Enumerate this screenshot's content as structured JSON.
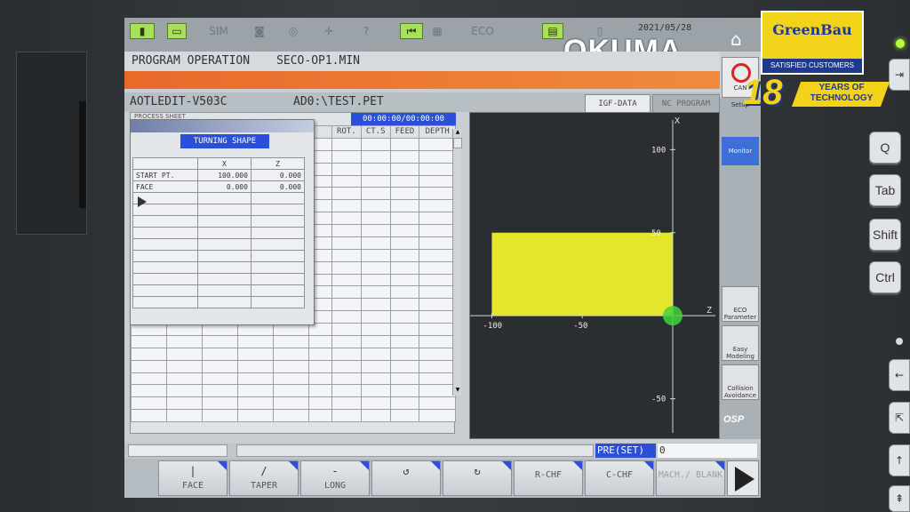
{
  "statusbar": {
    "icons": [
      "slot-icon",
      "sim-icon",
      "record-icon",
      "disc-icon",
      "crosshair-icon",
      "help-icon",
      "rewind-icon",
      "eco-icon",
      "folder-icon",
      "document-icon"
    ],
    "sim_label": "SIM",
    "eco_label": "ECO",
    "date": "2021/05/28",
    "brand": "OKUMA"
  },
  "header": {
    "mode": "PROGRAM OPERATION",
    "file": "SECO-OP1.MIN",
    "app": "AOTLEDIT-V503C",
    "path": "AD0:\\TEST.PET",
    "cancel_label": "CAN"
  },
  "tabs": [
    {
      "label": "IGF-DATA",
      "active": true
    },
    {
      "label": "NC PROGRAM",
      "active": false
    }
  ],
  "sheet": {
    "label": "PROCESS SHEET",
    "timer": "00:00:00/00:00:00",
    "columns": [
      "ROT.",
      "CT.S",
      "FEED",
      "DEPTH"
    ]
  },
  "popup": {
    "title": "TURNING SHAPE",
    "col_x": "X",
    "col_z": "Z",
    "rows": [
      {
        "label": "START PT.",
        "x": "100.000",
        "z": "0.000"
      },
      {
        "label": "FACE",
        "x": "0.000",
        "z": "0.000"
      }
    ]
  },
  "chart_data": {
    "type": "area",
    "title": "",
    "xlabel": "Z",
    "ylabel": "X",
    "x_ticks": [
      -100,
      -50
    ],
    "y_ticks": [
      100,
      50,
      -50
    ],
    "xlim": [
      -112,
      0
    ],
    "ylim": [
      -62,
      120
    ],
    "shape": {
      "z_min": -100,
      "z_max": 0,
      "x_min": 0,
      "x_max": 50,
      "color": "#e4e62c"
    },
    "tool_point": {
      "z": 0,
      "x": 0,
      "color": "#3fd43a"
    }
  },
  "sidebar": {
    "setup": "Setup",
    "monitor": "Monitor",
    "eco_param": "ECO Parameter",
    "easy_model": "Easy Modeling",
    "collision": "Collision Avoidance",
    "osp": "OSP"
  },
  "status": {
    "preset_label": "PRE(SET)",
    "preset_value": "0"
  },
  "fkeys": [
    {
      "symbol": "|",
      "label": "FACE",
      "corner": true,
      "disabled": false
    },
    {
      "symbol": "/",
      "label": "TAPER",
      "corner": true,
      "disabled": false
    },
    {
      "symbol": "-",
      "label": "LONG",
      "corner": true,
      "disabled": false
    },
    {
      "symbol": "↺",
      "label": "",
      "corner": true,
      "disabled": false
    },
    {
      "symbol": "↻",
      "label": "",
      "corner": true,
      "disabled": false
    },
    {
      "symbol": "",
      "label": "R-CHF",
      "corner": true,
      "disabled": false
    },
    {
      "symbol": "",
      "label": "C-CHF",
      "corner": true,
      "disabled": false
    },
    {
      "symbol": "",
      "label": "MACH./ BLANK",
      "corner": true,
      "disabled": true
    }
  ],
  "keyboard": [
    "Q",
    "Tab",
    "Shift",
    "Ctrl"
  ],
  "badge": {
    "name": "GreenBau",
    "tagline": "SATISFIED CUSTOMERS",
    "years": "18",
    "years_text": "YEARS OF TECHNOLOGY"
  }
}
